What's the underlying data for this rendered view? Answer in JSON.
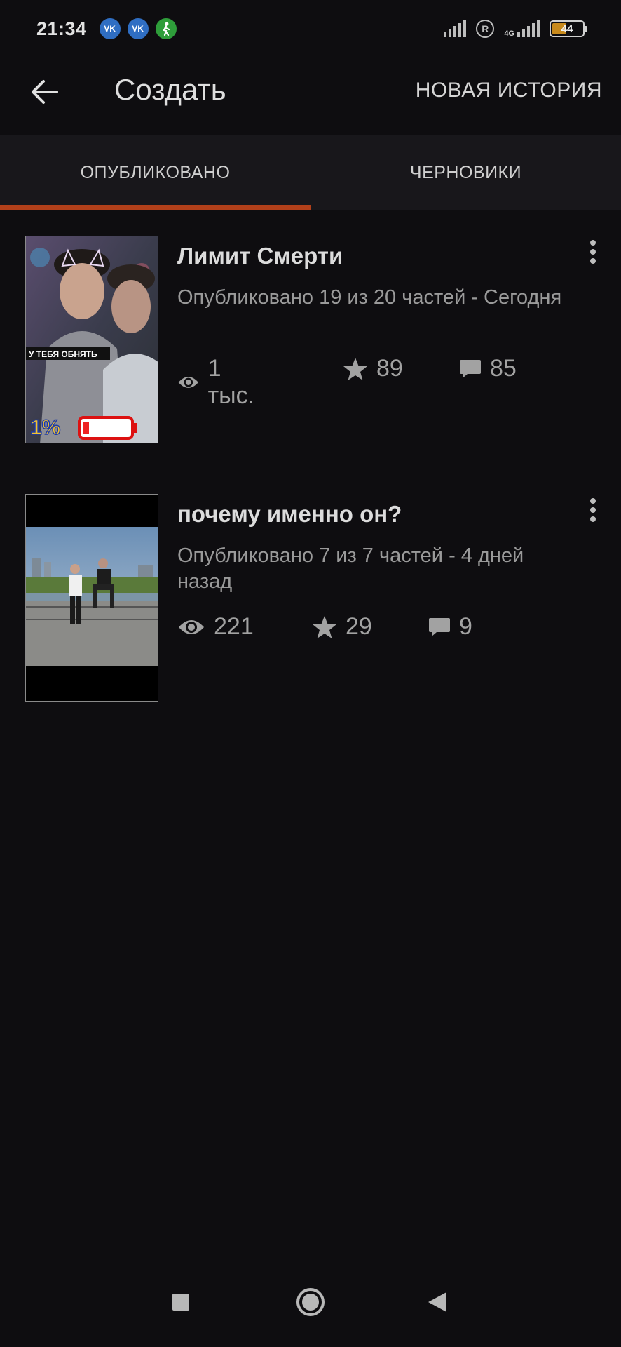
{
  "status_bar": {
    "time": "21:34",
    "apps": [
      {
        "icon": "vk-icon",
        "label": "VK",
        "color": "#2f6ec3"
      },
      {
        "icon": "vk-icon",
        "label": "VK",
        "color": "#2f6ec3"
      },
      {
        "icon": "walk-icon",
        "label": "",
        "color": "#2e9d3a"
      }
    ],
    "network_label": "4G",
    "battery_level": "44",
    "battery_fraction": 0.44
  },
  "appbar": {
    "title": "Создать",
    "action": "НОВАЯ ИСТОРИЯ"
  },
  "tabs": [
    {
      "label": "ОПУБЛИКОВАНО",
      "active": true
    },
    {
      "label": "ЧЕРНОВИКИ",
      "active": false
    }
  ],
  "colors": {
    "accent": "#b2401a",
    "background": "#0e0d10",
    "tabbar": "#18171b"
  },
  "stories": [
    {
      "title": "Лимит Смерти",
      "meta": "Опубликовано 19 из 20 частей - Сегодня",
      "views": "1 тыс.",
      "votes": "89",
      "comments": "85",
      "cover_caption": "У ТЕБЯ ОБНЯТЬ",
      "cover_badge": "1%"
    },
    {
      "title": "почему именно он?",
      "meta": "Опубликовано 7 из 7 частей - 4 дней назад",
      "views": "221",
      "votes": "29",
      "comments": "9"
    }
  ]
}
